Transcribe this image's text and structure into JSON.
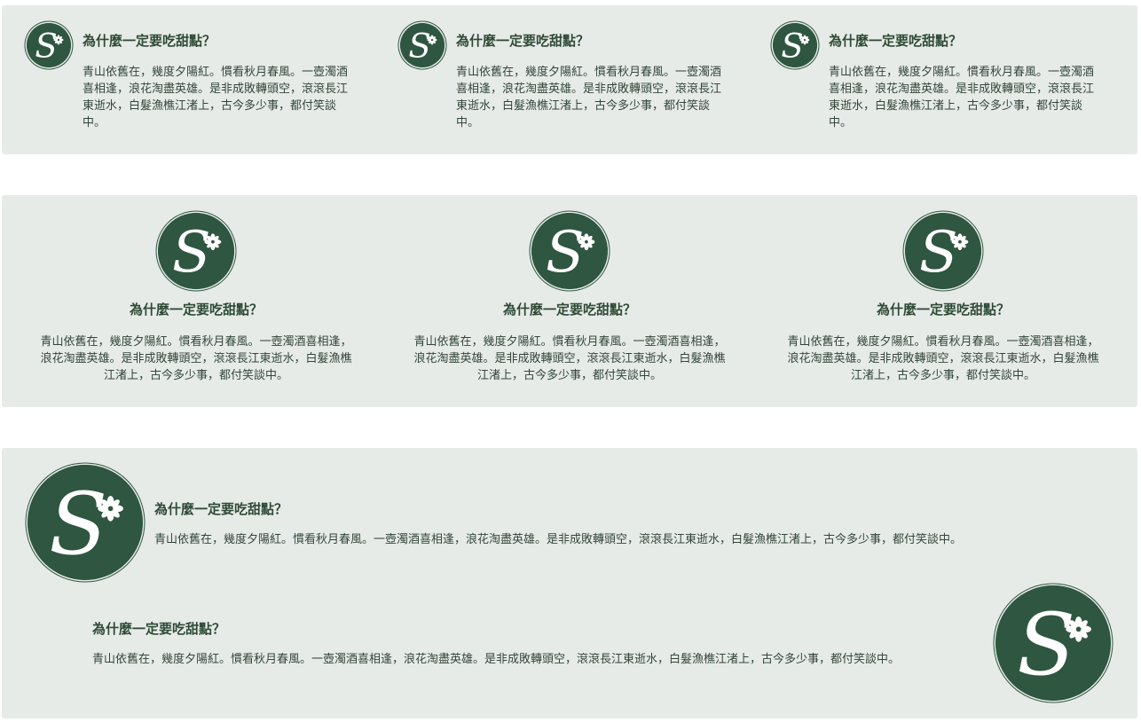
{
  "theme": {
    "panel_bg": "#e6ebe7",
    "logo_bg": "#2f5640",
    "logo_fg": "#ffffff",
    "text": "#2e4a36"
  },
  "logo": {
    "letter": "S",
    "mark": "✻",
    "icon": "sweet-s-logo-icon"
  },
  "row1": {
    "cards": [
      {
        "title": "為什麼一定要吃甜點？",
        "text": "青山依舊在，幾度夕陽紅。慣看秋月春風。一壺濁酒喜相逢，浪花淘盡英雄。是非成敗轉頭空，滾滾長江東逝水，白髮漁樵江渚上，古今多少事，都付笑談中。"
      },
      {
        "title": "為什麼一定要吃甜點？",
        "text": "青山依舊在，幾度夕陽紅。慣看秋月春風。一壺濁酒喜相逢，浪花淘盡英雄。是非成敗轉頭空，滾滾長江東逝水，白髮漁樵江渚上，古今多少事，都付笑談中。"
      },
      {
        "title": "為什麼一定要吃甜點？",
        "text": "青山依舊在，幾度夕陽紅。慣看秋月春風。一壺濁酒喜相逢，浪花淘盡英雄。是非成敗轉頭空，滾滾長江東逝水，白髮漁樵江渚上，古今多少事，都付笑談中。"
      }
    ]
  },
  "row2": {
    "cards": [
      {
        "title": "為什麼一定要吃甜點？",
        "text": "青山依舊在，幾度夕陽紅。慣看秋月春風。一壺濁酒喜相逢，浪花淘盡英雄。是非成敗轉頭空，滾滾長江東逝水，白髮漁樵江渚上，古今多少事，都付笑談中。"
      },
      {
        "title": "為什麼一定要吃甜點？",
        "text": "青山依舊在，幾度夕陽紅。慣看秋月春風。一壺濁酒喜相逢，浪花淘盡英雄。是非成敗轉頭空，滾滾長江東逝水，白髮漁樵江渚上，古今多少事，都付笑談中。"
      },
      {
        "title": "為什麼一定要吃甜點？",
        "text": "青山依舊在，幾度夕陽紅。慣看秋月春風。一壺濁酒喜相逢，浪花淘盡英雄。是非成敗轉頭空，滾滾長江東逝水，白髮漁樵江渚上，古今多少事，都付笑談中。"
      }
    ]
  },
  "row3": {
    "cards": [
      {
        "title": "為什麼一定要吃甜點？",
        "text": "青山依舊在，幾度夕陽紅。慣看秋月春風。一壺濁酒喜相逢，浪花淘盡英雄。是非成敗轉頭空，滾滾長江東逝水，白髮漁樵江渚上，古今多少事，都付笑談中。"
      },
      {
        "title": "為什麼一定要吃甜點？",
        "text": "青山依舊在，幾度夕陽紅。慣看秋月春風。一壺濁酒喜相逢，浪花淘盡英雄。是非成敗轉頭空，滾滾長江東逝水，白髮漁樵江渚上，古今多少事，都付笑談中。"
      }
    ]
  }
}
